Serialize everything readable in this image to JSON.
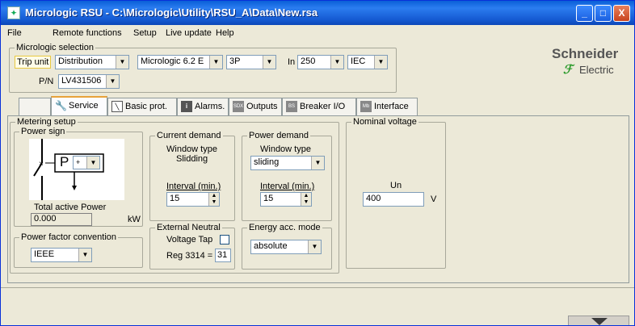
{
  "window": {
    "title": "Micrologic RSU - C:\\Micrologic\\Utility\\RSU_A\\Data\\New.rsa",
    "minimize": "_",
    "maximize": "□",
    "close": "X"
  },
  "menu": {
    "items": [
      "File",
      "Remote functions",
      "Setup",
      "Live update",
      "Help"
    ]
  },
  "micrologic_selection": {
    "label": "Micrologic selection",
    "trip_unit_label": "Trip unit",
    "trip_unit_value": "Distribution",
    "model_value": "Micrologic 6.2 E",
    "poles_value": "3P",
    "in_label": "In",
    "in_value": "250",
    "standard_value": "IEC",
    "pn_label": "P/N",
    "pn_value": "LV431506"
  },
  "logo": {
    "line1": "Schneider",
    "line2": "Electric"
  },
  "tabs": [
    {
      "label": "Service",
      "icon": "wrench-icon"
    },
    {
      "label": "Basic prot.",
      "icon": "curve-icon"
    },
    {
      "label": "Alarms.",
      "icon": "info-icon"
    },
    {
      "label": "Outputs",
      "icon": "sdx-icon"
    },
    {
      "label": "Breaker I/O",
      "icon": "bsc-icon"
    },
    {
      "label": "Interface",
      "icon": "modbus-icon"
    }
  ],
  "metering_setup": {
    "label": "Metering setup",
    "power_sign": {
      "label": "Power sign",
      "p_letter": "P",
      "sign_value": "+",
      "total_label": "Total active Power",
      "total_value": "0.000",
      "total_unit": "kW"
    },
    "current_demand": {
      "label": "Current demand",
      "window_type_label": "Window type",
      "window_type_value": "Slidding",
      "interval_label": "Interval  (min.)",
      "interval_value": "15"
    },
    "power_demand": {
      "label": "Power demand",
      "window_type_label": "Window type",
      "window_type_value": "sliding",
      "interval_label": "Interval  (min.)",
      "interval_value": "15"
    },
    "power_factor": {
      "label": "Power factor convention",
      "value": "IEEE"
    },
    "external_neutral": {
      "label": "External Neutral",
      "voltage_tap_label": "Voltage Tap",
      "reg_label": "Reg 3314 =",
      "reg_value": "31"
    },
    "energy_mode": {
      "label": "Energy  acc. mode",
      "value": "absolute"
    }
  },
  "nominal_voltage": {
    "label": "Nominal voltage",
    "un_label": "Un",
    "un_value": "400",
    "unit": "V"
  }
}
